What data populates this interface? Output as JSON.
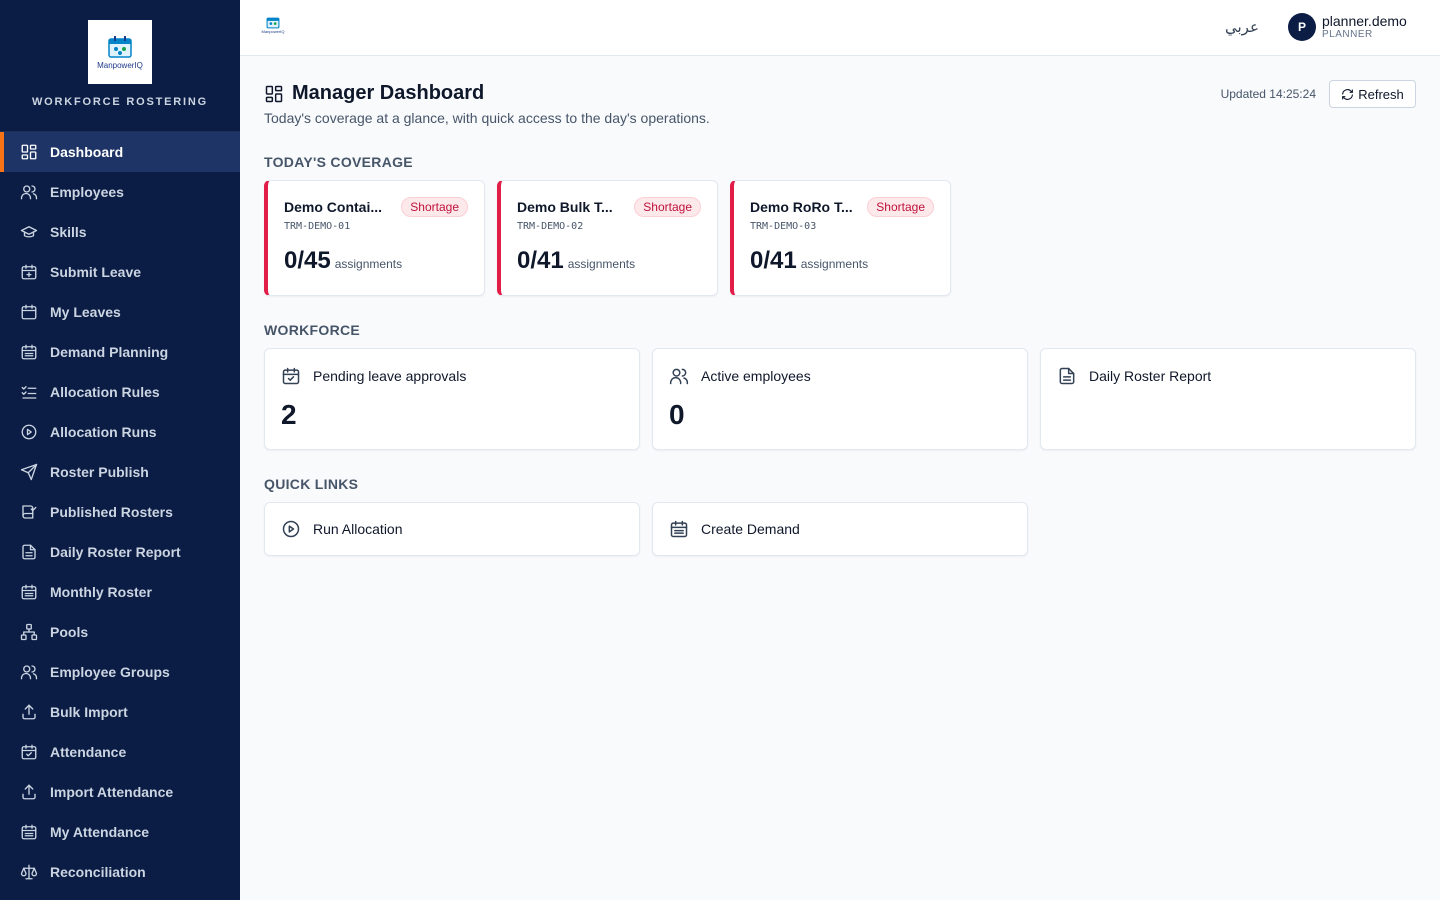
{
  "brand": {
    "logo_text": "ManpowerIQ",
    "subtitle": "WORKFORCE ROSTERING"
  },
  "sidebar": {
    "items": [
      {
        "label": "Dashboard",
        "icon": "dashboard-icon",
        "active": true
      },
      {
        "label": "Employees",
        "icon": "users-icon"
      },
      {
        "label": "Skills",
        "icon": "graduation-cap-icon"
      },
      {
        "label": "Submit Leave",
        "icon": "calendar-plus-icon"
      },
      {
        "label": "My Leaves",
        "icon": "calendar-icon"
      },
      {
        "label": "Demand Planning",
        "icon": "calendar-grid-icon"
      },
      {
        "label": "Allocation Rules",
        "icon": "list-checks-icon"
      },
      {
        "label": "Allocation Runs",
        "icon": "play-circle-icon"
      },
      {
        "label": "Roster Publish",
        "icon": "send-icon"
      },
      {
        "label": "Published Rosters",
        "icon": "book-check-icon"
      },
      {
        "label": "Daily Roster Report",
        "icon": "file-text-icon"
      },
      {
        "label": "Monthly Roster",
        "icon": "calendar-grid-icon"
      },
      {
        "label": "Pools",
        "icon": "network-icon"
      },
      {
        "label": "Employee Groups",
        "icon": "users-icon"
      },
      {
        "label": "Bulk Import",
        "icon": "upload-icon"
      },
      {
        "label": "Attendance",
        "icon": "calendar-check-icon"
      },
      {
        "label": "Import Attendance",
        "icon": "upload-icon"
      },
      {
        "label": "My Attendance",
        "icon": "calendar-grid-icon"
      },
      {
        "label": "Reconciliation",
        "icon": "scale-icon"
      }
    ]
  },
  "topbar": {
    "language_toggle": "عربي",
    "user": {
      "initial": "P",
      "name": "planner.demo",
      "role": "PLANNER"
    }
  },
  "header": {
    "title": "Manager Dashboard",
    "subtitle": "Today's coverage at a glance, with quick access to the day's operations.",
    "updated": "Updated 14:25:24",
    "refresh_label": "Refresh"
  },
  "coverage": {
    "section_label": "TODAY'S COVERAGE",
    "cards": [
      {
        "name": "Demo Contai...",
        "code": "TRM-DEMO-01",
        "badge": "Shortage",
        "value": "0/45",
        "unit": "assignments"
      },
      {
        "name": "Demo Bulk T...",
        "code": "TRM-DEMO-02",
        "badge": "Shortage",
        "value": "0/41",
        "unit": "assignments"
      },
      {
        "name": "Demo RoRo T...",
        "code": "TRM-DEMO-03",
        "badge": "Shortage",
        "value": "0/41",
        "unit": "assignments"
      }
    ]
  },
  "workforce": {
    "section_label": "WORKFORCE",
    "cards": [
      {
        "label": "Pending leave approvals",
        "value": "2",
        "icon": "calendar-check-icon"
      },
      {
        "label": "Active employees",
        "value": "0",
        "icon": "users-icon"
      },
      {
        "label": "Daily Roster Report",
        "value": "",
        "icon": "file-text-icon"
      }
    ]
  },
  "quick_links": {
    "section_label": "QUICK LINKS",
    "items": [
      {
        "label": "Run Allocation",
        "icon": "play-circle-icon"
      },
      {
        "label": "Create Demand",
        "icon": "calendar-grid-icon"
      }
    ]
  },
  "colors": {
    "sidebar_bg": "#0b1c45",
    "active_accent": "#f97316",
    "shortage_red": "#e11d48"
  }
}
